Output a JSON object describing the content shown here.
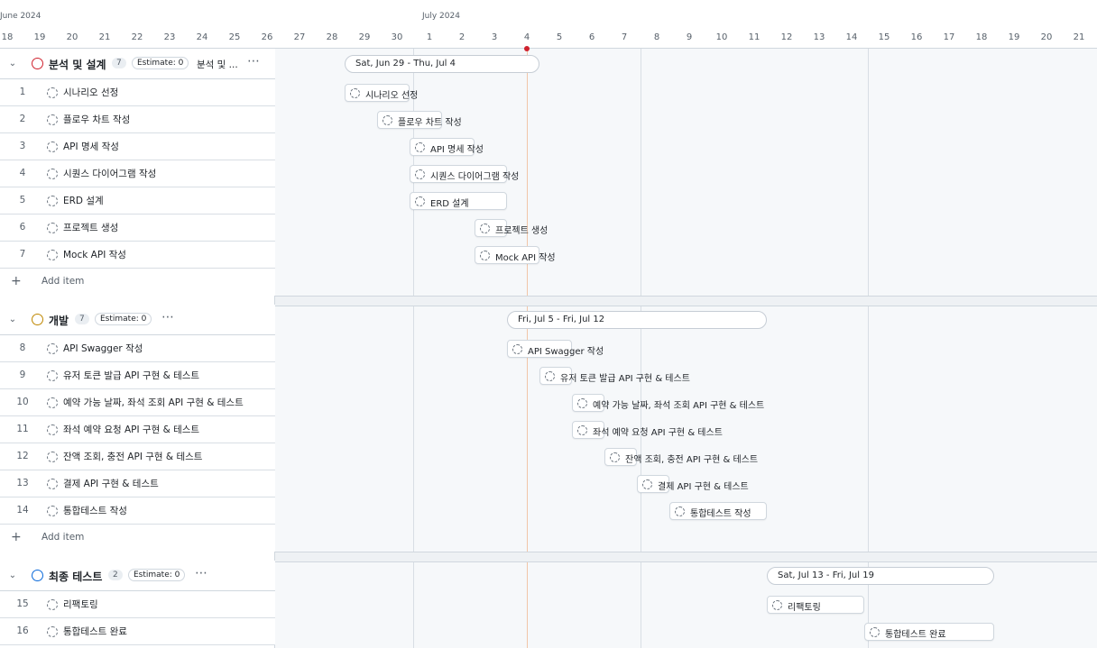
{
  "timeline": {
    "months": [
      {
        "label": "June 2024",
        "first_day": 18
      },
      {
        "label": "July 2024",
        "first_day": 1
      }
    ],
    "days": [
      "18",
      "19",
      "20",
      "21",
      "22",
      "23",
      "24",
      "25",
      "26",
      "27",
      "28",
      "29",
      "30",
      "1",
      "2",
      "3",
      "4",
      "5",
      "6",
      "7",
      "8",
      "9",
      "10",
      "11",
      "12",
      "13",
      "14",
      "15",
      "16",
      "17",
      "18",
      "19",
      "20",
      "21"
    ],
    "today": "4",
    "today_color": "#cf222e"
  },
  "groups": [
    {
      "name": "분석 및 설계",
      "status_color": "#cf222e",
      "count": "7",
      "estimate": "Estimate: 0",
      "extra": "분석 및 ...",
      "more": "⋯",
      "range_label": "Sat, Jun 29 - Thu, Jul 4",
      "items": [
        {
          "num": "1",
          "title": "시나리오 선정"
        },
        {
          "num": "2",
          "title": "플로우 차트 작성"
        },
        {
          "num": "3",
          "title": "API 명세 작성"
        },
        {
          "num": "4",
          "title": "시퀀스 다이어그램 작성"
        },
        {
          "num": "5",
          "title": "ERD 설계"
        },
        {
          "num": "6",
          "title": "프로젝트 생성"
        },
        {
          "num": "7",
          "title": "Mock API 작성"
        }
      ],
      "add_label": "Add item"
    },
    {
      "name": "개발",
      "status_color": "#bf8700",
      "count": "7",
      "estimate": "Estimate: 0",
      "extra": "",
      "more": "⋯",
      "range_label": "Fri, Jul 5 - Fri, Jul 12",
      "items": [
        {
          "num": "8",
          "title": "API Swagger 작성"
        },
        {
          "num": "9",
          "title": "유저 토큰 발급 API 구현 & 테스트"
        },
        {
          "num": "10",
          "title": "예약 가능 날짜, 좌석 조회 API 구현 & 테스트"
        },
        {
          "num": "11",
          "title": "좌석 예약 요청 API 구현 & 테스트"
        },
        {
          "num": "12",
          "title": "잔액 조회, 충전 API 구현 & 테스트"
        },
        {
          "num": "13",
          "title": "결제 API 구현 & 테스트"
        },
        {
          "num": "14",
          "title": "통합테스트 작성"
        }
      ],
      "add_label": "Add item"
    },
    {
      "name": "최종 테스트",
      "status_color": "#0969da",
      "count": "2",
      "estimate": "Estimate: 0",
      "extra": "",
      "more": "⋯",
      "range_label": "Sat, Jul 13 - Fri, Jul 19",
      "items": [
        {
          "num": "15",
          "title": "리팩토링"
        },
        {
          "num": "16",
          "title": "통합테스트 완료"
        }
      ],
      "add_label": ""
    }
  ]
}
